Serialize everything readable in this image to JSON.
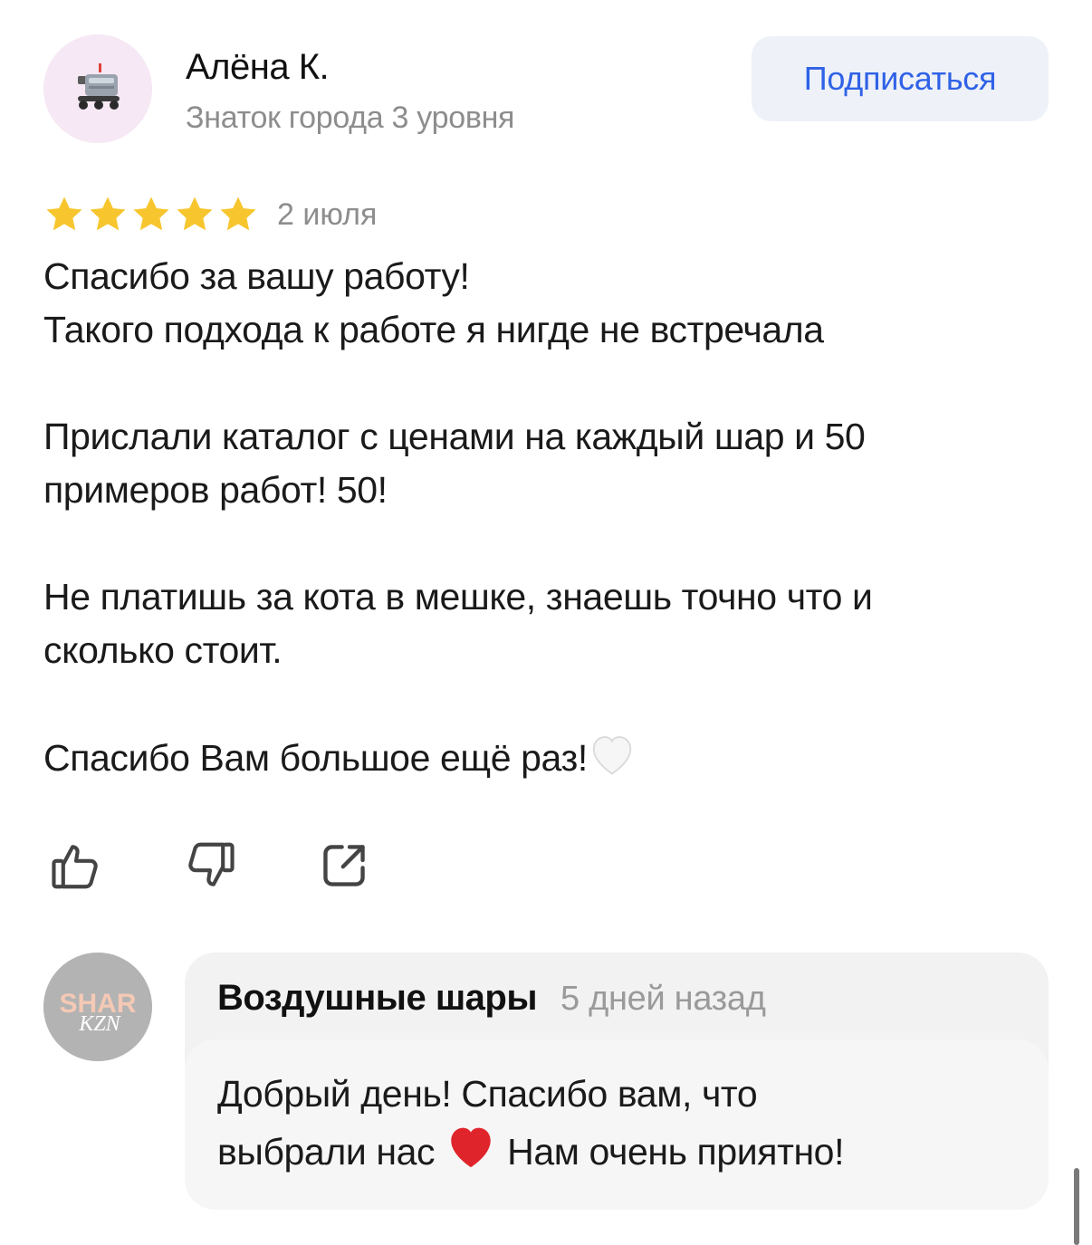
{
  "author": {
    "name": "Алёна К.",
    "level": "Знаток города 3 уровня",
    "avatar_icon": "delivery-robot-icon"
  },
  "subscribe_label": "Подписаться",
  "review": {
    "rating": 5,
    "rating_max": 5,
    "date": "2 июля",
    "line1": "Спасибо за вашу работу!",
    "line2": "Такого подхода к работе я нигде не встречала",
    "line3": "Прислали каталог с ценами на каждый шар и 50",
    "line4": "примеров работ! 50!",
    "line5": "Не платишь за кота в мешке, знаешь точно что и",
    "line6": "сколько стоит.",
    "line7": "Спасибо Вам большое ещё раз!",
    "line7_emoji": "white-heart-icon"
  },
  "actions": {
    "like_icon": "thumbs-up-icon",
    "dislike_icon": "thumbs-down-icon",
    "share_icon": "share-icon"
  },
  "reply": {
    "avatar_text_top": "SHAR",
    "avatar_text_bottom": "KZN",
    "name": "Воздушные шары",
    "time": "5 дней назад",
    "line1": "Добрый день! Спасибо вам, что",
    "line2_a": "выбрали нас",
    "line2_b": "Нам очень приятно!",
    "emoji": "red-heart-icon"
  },
  "colors": {
    "accent": "#2f62e6",
    "star": "#f7c62f",
    "muted": "#8d8d8d"
  }
}
